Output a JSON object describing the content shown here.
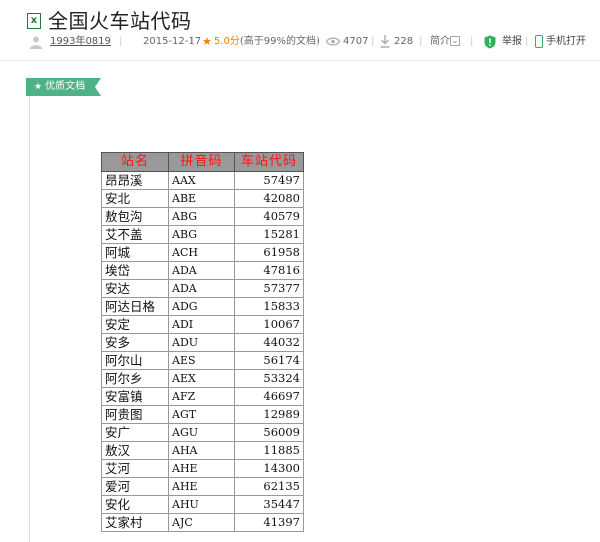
{
  "doc": {
    "file_icon_glyph": "x",
    "title": "全国火车站代码",
    "author": "1993年0819",
    "date": "2015-12-17",
    "score": "5.0分",
    "score_note": "(高于99%的文档)",
    "views": "4707",
    "downloads": "228",
    "intro_label": "简介",
    "report_label": "举报",
    "mobile_label": "手机打开",
    "badge": "优质文档",
    "separator": "|"
  },
  "colors": {
    "accent_green": "#4fb286",
    "rating_orange": "#ff7e00",
    "header_fill": "#999999",
    "header_text": "#ff1111"
  },
  "icons": [
    "excel-file-icon",
    "user-icon",
    "star-icon",
    "eye-icon",
    "download-icon",
    "chevron-down-icon",
    "shield-icon",
    "phone-icon"
  ],
  "table": {
    "headers": [
      "站名",
      "拼音码",
      "车站代码"
    ],
    "rows": [
      [
        "昂昂溪",
        "AAX",
        "57497"
      ],
      [
        "安北",
        "ABE",
        "42080"
      ],
      [
        "敖包沟",
        "ABG",
        "40579"
      ],
      [
        "艾不盖",
        "ABG",
        "15281"
      ],
      [
        "阿城",
        "ACH",
        "61958"
      ],
      [
        "埃岱",
        "ADA",
        "47816"
      ],
      [
        "安达",
        "ADA",
        "57377"
      ],
      [
        "阿达日格",
        "ADG",
        "15833"
      ],
      [
        "安定",
        "ADI",
        "10067"
      ],
      [
        "安多",
        "ADU",
        "44032"
      ],
      [
        "阿尔山",
        "AES",
        "56174"
      ],
      [
        "阿尔乡",
        "AEX",
        "53324"
      ],
      [
        "安富镇",
        "AFZ",
        "46697"
      ],
      [
        "阿贵图",
        "AGT",
        "12989"
      ],
      [
        "安广",
        "AGU",
        "56009"
      ],
      [
        "敖汉",
        "AHA",
        "11885"
      ],
      [
        "艾河",
        "AHE",
        "14300"
      ],
      [
        "爱河",
        "AHE",
        "62135"
      ],
      [
        "安化",
        "AHU",
        "35447"
      ],
      [
        "艾家村",
        "AJC",
        "41397"
      ]
    ]
  }
}
